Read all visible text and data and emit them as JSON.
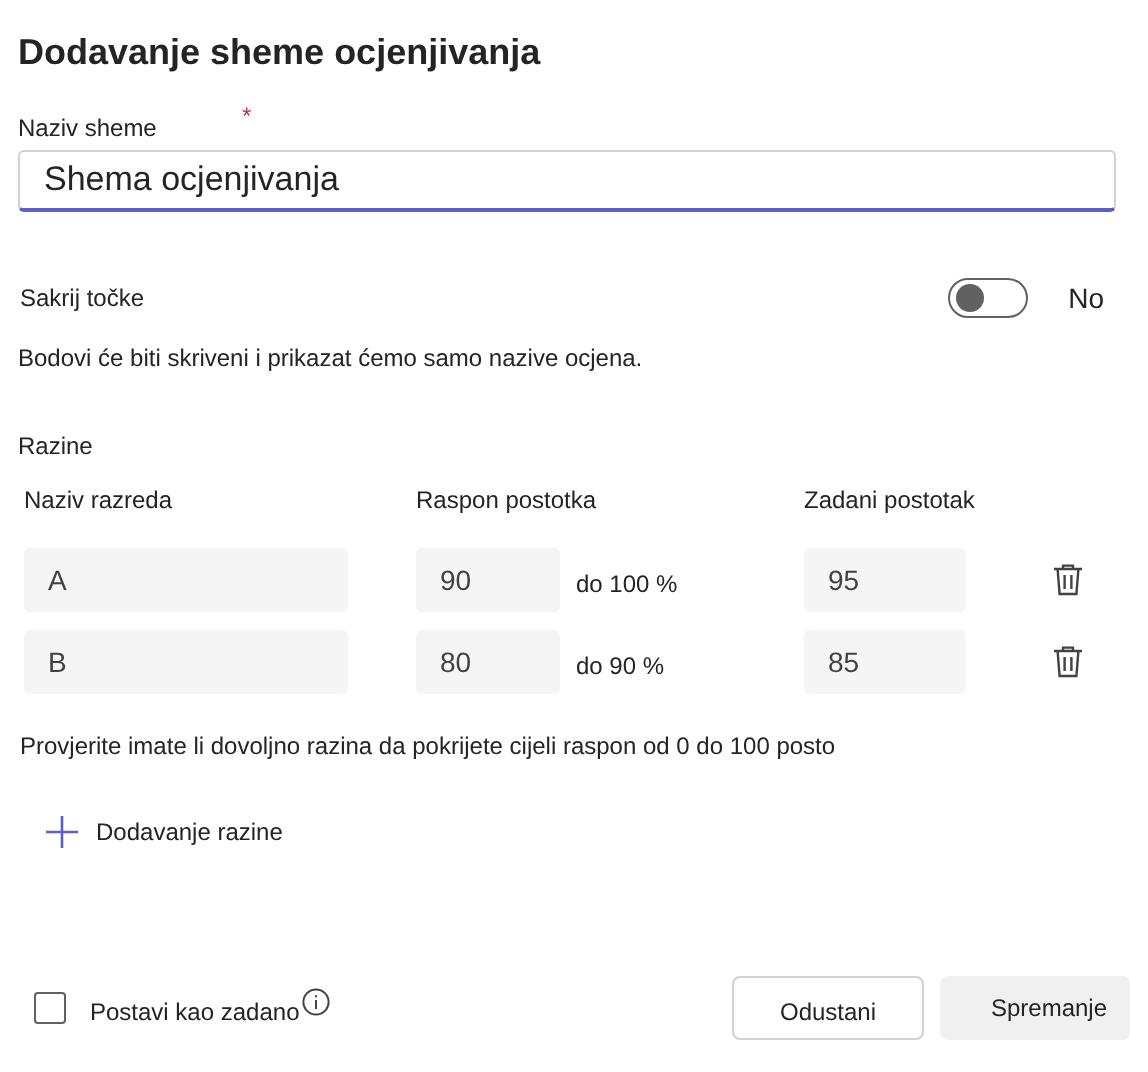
{
  "title": "Dodavanje sheme ocjenjivanja",
  "scheme_name": {
    "label": "Naziv sheme",
    "required_mark": "*",
    "value": "Shema ocjenjivanja"
  },
  "hide_points": {
    "label": "Sakrij točke",
    "on": false,
    "state_label": "No",
    "description": "Bodovi će biti skriveni i prikazat ćemo samo nazive ocjena."
  },
  "levels": {
    "title": "Razine",
    "columns": [
      "Naziv razreda",
      "Raspon postotka",
      "Zadani postotak"
    ],
    "rows": [
      {
        "name": "A",
        "from": "90",
        "to": "do 100 %",
        "default": "95"
      },
      {
        "name": "B",
        "from": "80",
        "to": "do 90 %",
        "default": "85"
      }
    ],
    "note": "Provjerite imate li dovoljno razina da pokrijete cijeli raspon od 0 do 100 posto",
    "add_label": "Dodavanje razine"
  },
  "set_default": {
    "label": "Postavi kao zadano",
    "checked": false
  },
  "buttons": [
    "Odustani",
    "Spremanje"
  ]
}
